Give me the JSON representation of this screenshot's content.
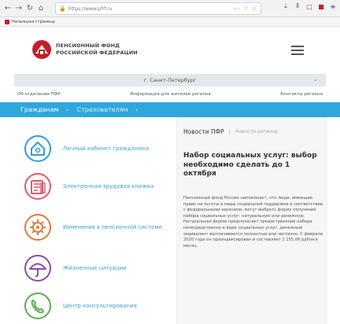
{
  "browser": {
    "url_text": "https://www.pfrf.ru",
    "bookmark_label": "Начальная страница"
  },
  "site": {
    "logo_line1": "ПЕНСИОННЫЙ ФОНД",
    "logo_line2": "РОССИЙСКОЙ ФЕДЕРАЦИИ",
    "region": "г. Санкт-Петербург",
    "subnav": [
      "Об отделении ПФР",
      "Информация для жителей региона",
      "Контакты региона"
    ],
    "tabs": [
      {
        "label": "Гражданам"
      },
      {
        "label": "Страхователям"
      }
    ],
    "services": [
      {
        "label": "Личный кабинет гражданина",
        "icon": "home-icon",
        "color": "#2f9fd8"
      },
      {
        "label": "Электронная трудовая книжка",
        "icon": "book-icon",
        "color": "#e05a6a"
      },
      {
        "label": "Изменения в пенсионной системе",
        "icon": "gear-icon",
        "color": "#e07a3a"
      },
      {
        "label": "Жизненные ситуации",
        "icon": "umbrella-icon",
        "color": "#8a4ab0"
      },
      {
        "label": "Центр консультирования",
        "icon": "phone-icon",
        "color": "#5ab04a"
      }
    ],
    "news": {
      "tab_active": "Новости ПФР",
      "tab_inactive": "Новости региона",
      "title": "Набор социальных услуг: выбор необходимо сделать до 1 октября",
      "body": "Пенсионный фонд России напоминает, что люди, имеющие право на льготы и меры социальной поддержки в соответствии с федеральными законами, могут выбрать форму получения набора социальных услуг: натуральную или денежную. Натуральная форма предполагает предоставление набора непосредственно в виде социальных услуг, денежный эквивалент выплачивается полностью или частично. С февраля 2020 года он проиндексирован и составляет 1 155,06 рубля в месяц."
    }
  },
  "colors": {
    "accent": "#2fa7dd",
    "logo_red": "#c41e2b",
    "link": "#3aa2d8"
  }
}
